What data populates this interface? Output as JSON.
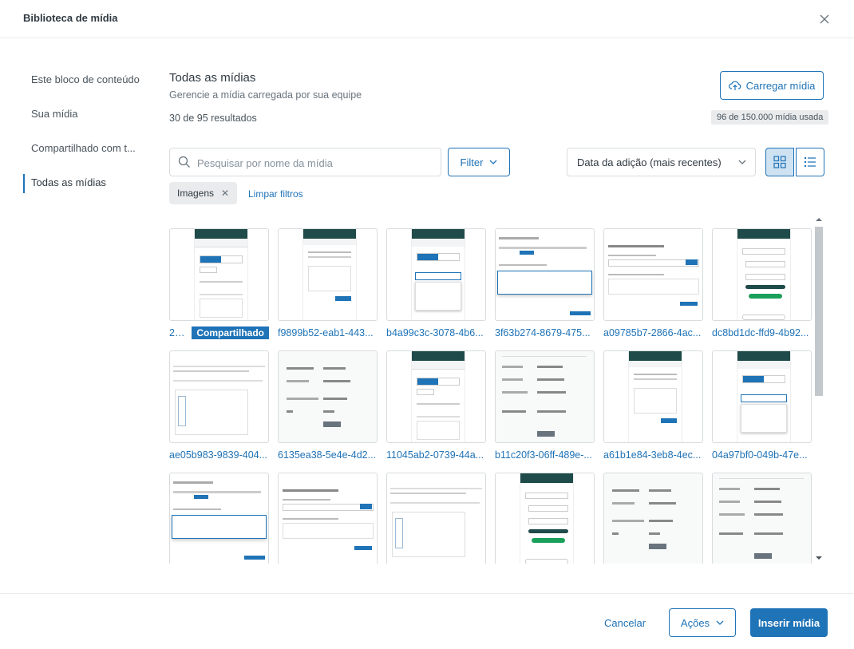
{
  "dialog": {
    "title": "Biblioteca de mídia"
  },
  "sidebar": {
    "items": [
      {
        "label": "Este bloco de conteúdo"
      },
      {
        "label": "Sua mídia"
      },
      {
        "label": "Compartilhado com t..."
      },
      {
        "label": "Todas as mídias",
        "active": true
      }
    ]
  },
  "main": {
    "title": "Todas as mídias",
    "subtitle": "Gerencie a mídia carregada por sua equipe",
    "results": "30 de 95 resultados",
    "upload_label": "Carregar mídia",
    "usage": "96 de 150.000 mídia usada"
  },
  "toolbar": {
    "search_placeholder": "Pesquisar por nome da mídia",
    "filter_label": "Filter",
    "sort_label": "Data da adição (mais recentes)"
  },
  "filters": {
    "chip_label": "Imagens",
    "clear_label": "Limpar filtros"
  },
  "media": [
    {
      "name": "29f...",
      "badge": "Compartilhado",
      "kind": "app"
    },
    {
      "name": "f9899b52-eab1-443...",
      "kind": "dialog"
    },
    {
      "name": "b4a99c3c-3078-4b6...",
      "kind": "app-list"
    },
    {
      "name": "3f63b274-8679-475...",
      "kind": "doc-dropdown"
    },
    {
      "name": "a09785b7-2866-4ac...",
      "kind": "feedback"
    },
    {
      "name": "dc8bd1dc-ffd9-4b92...",
      "kind": "chat"
    },
    {
      "name": "ae05b983-9839-404...",
      "kind": "textdoc"
    },
    {
      "name": "6135ea38-5e4e-4d2...",
      "kind": "props"
    },
    {
      "name": "11045ab2-0739-44a...",
      "kind": "app"
    },
    {
      "name": "b11c20f3-06ff-489e-...",
      "kind": "props2"
    },
    {
      "name": "a61b1e84-3eb8-4ec...",
      "kind": "dialog"
    },
    {
      "name": "04a97bf0-049b-47e...",
      "kind": "app-list"
    },
    {
      "name": "",
      "kind": "doc-dropdown"
    },
    {
      "name": "",
      "kind": "feedback"
    },
    {
      "name": "",
      "kind": "textdoc"
    },
    {
      "name": "",
      "kind": "chat"
    },
    {
      "name": "",
      "kind": "props"
    },
    {
      "name": "",
      "kind": "props2"
    }
  ],
  "footer": {
    "cancel_label": "Cancelar",
    "actions_label": "Ações",
    "insert_label": "Inserir mídia"
  },
  "colors": {
    "accent": "#1f73b7",
    "border": "#d8dcde",
    "muted_text": "#68737d",
    "app_header": "#1f4b4a"
  },
  "icons": [
    "close-icon",
    "upload-cloud-icon",
    "search-icon",
    "chevron-down-icon",
    "grid-view-icon",
    "list-view-icon"
  ]
}
